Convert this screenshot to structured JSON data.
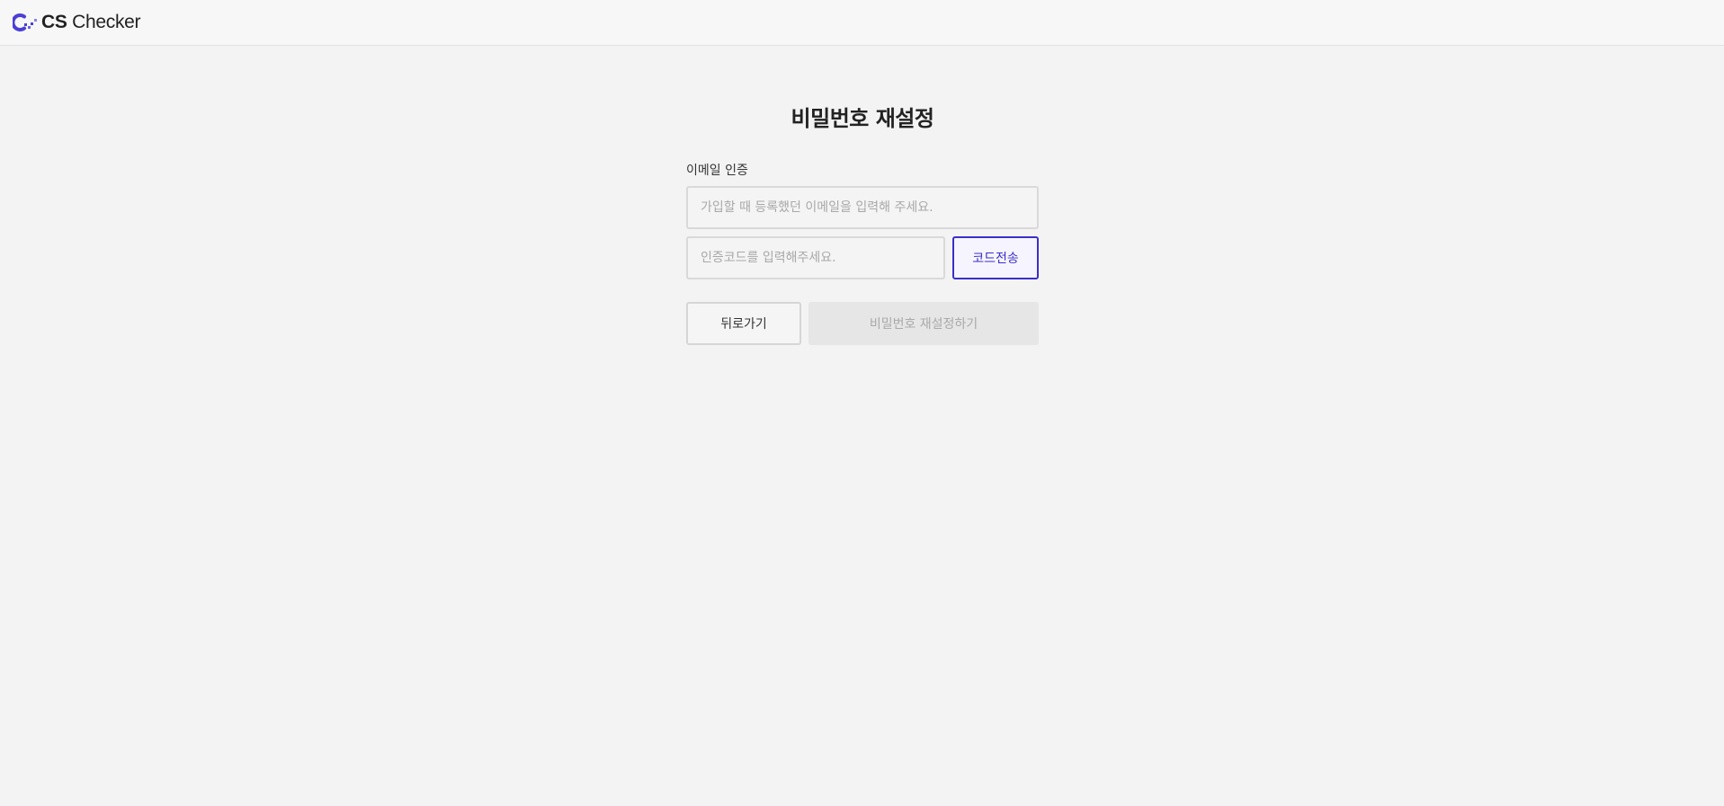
{
  "header": {
    "logo_bold": "CS",
    "logo_light": "Checker",
    "logo_icon": "cs-checker-logo-icon",
    "brand_color": "#3b2fc9"
  },
  "form": {
    "title": "비밀번호 재설정",
    "section_label": "이메일 인증",
    "email": {
      "value": "",
      "placeholder": "가입할 때 등록했던 이메일을 입력해 주세요."
    },
    "code": {
      "value": "",
      "placeholder": "인증코드를 입력해주세요."
    },
    "send_code_label": "코드전송",
    "back_label": "뒤로가기",
    "reset_label": "비밀번호 재설정하기"
  }
}
